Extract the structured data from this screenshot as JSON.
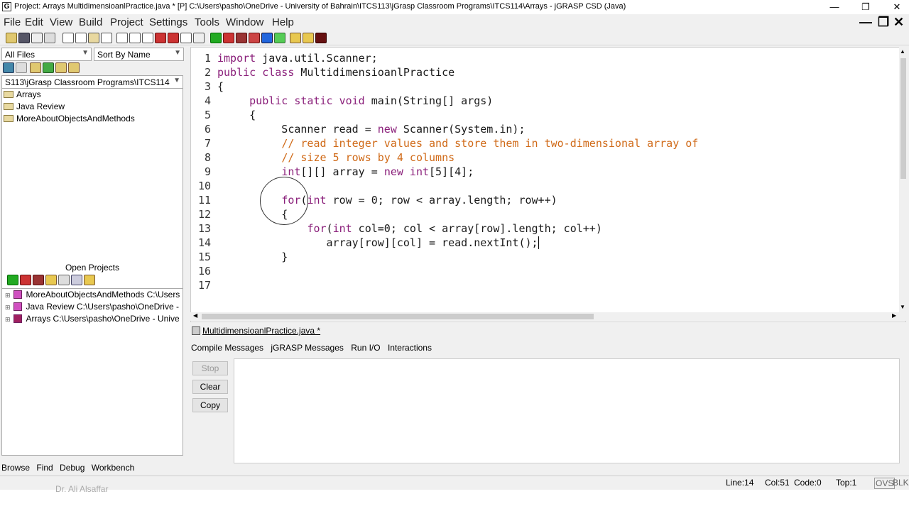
{
  "window": {
    "title": "Project: Arrays   MultidimensioanlPractice.java * [P]  C:\\Users\\pasho\\OneDrive - University of Bahrain\\ITCS113\\jGrasp Classroom Programs\\ITCS114\\Arrays - jGRASP CSD (Java)",
    "app_icon_letter": "G"
  },
  "menu": [
    "File",
    "Edit",
    "View",
    "Build",
    "Project",
    "Settings",
    "Tools",
    "Window",
    "Help"
  ],
  "browse": {
    "filter_combo": "All Files",
    "sort_combo": "Sort By Name",
    "path_combo": "S113\\jGrasp Classroom Programs\\ITCS114",
    "files": [
      "Arrays",
      "Java Review",
      "MoreAboutObjectsAndMethods"
    ]
  },
  "open_projects": {
    "title": "Open Projects",
    "items": [
      "MoreAboutObjectsAndMethods  C:\\Users",
      "Java Review  C:\\Users\\pasho\\OneDrive -",
      "Arrays  C:\\Users\\pasho\\OneDrive - Unive"
    ]
  },
  "left_tabs": [
    "Browse",
    "Find",
    "Debug",
    "Workbench"
  ],
  "editor": {
    "line_numbers": [
      "1",
      "2",
      "3",
      "4",
      "5",
      "6",
      "7",
      "8",
      "9",
      "10",
      "11",
      "12",
      "13",
      "14",
      "15",
      "16",
      "17"
    ],
    "tab_label": "MultidimensioanlPractice.java *"
  },
  "messages": {
    "tabs": [
      "Compile Messages",
      "jGRASP Messages",
      "Run I/O",
      "Interactions"
    ],
    "buttons": [
      "Stop",
      "Clear",
      "Copy"
    ]
  },
  "status": {
    "line": "Line:14",
    "col": "Col:51",
    "code": "Code:0",
    "top": "Top:1",
    "ovs": "OVS",
    "blk": "BLK"
  },
  "watermark": "Dr. Ali Alsaffar",
  "colors": {
    "keyword": "#8a1f7a",
    "comment": "#d06a18"
  }
}
